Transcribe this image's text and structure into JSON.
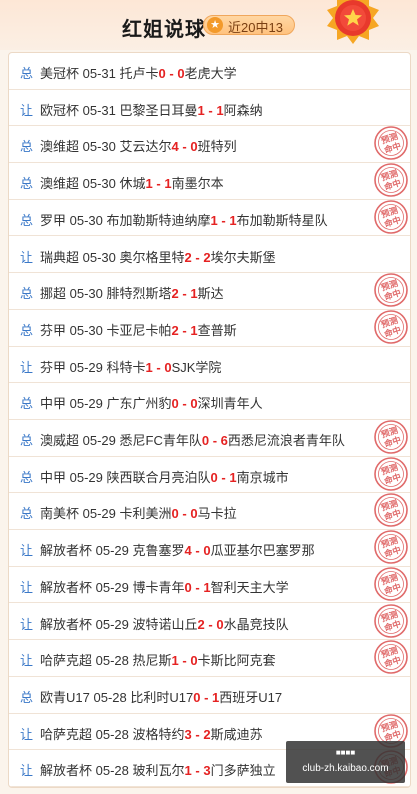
{
  "header": {
    "title": "红姐说球",
    "record": "近20中13",
    "star_icon": "star-icon",
    "medal_icon": "star-medal-icon"
  },
  "colors": {
    "accent": "#e52222",
    "type_label": "#3a78c8",
    "stamp": "#e06a6a"
  },
  "stamp_text": [
    "预测",
    "命中"
  ],
  "matches": [
    {
      "type": "总",
      "league": "美冠杯",
      "date": "05-31",
      "home": "托卢卡",
      "hs": "0",
      "as": "0",
      "away": "老虎大学",
      "hit": false
    },
    {
      "type": "让",
      "league": "欧冠杯",
      "date": "05-31",
      "home": "巴黎圣日耳曼",
      "hs": "1",
      "as": "1",
      "away": "阿森纳",
      "hit": false
    },
    {
      "type": "总",
      "league": "澳维超",
      "date": "05-30",
      "home": "艾云达尔",
      "hs": "4",
      "as": "0",
      "away": "班特列",
      "hit": true
    },
    {
      "type": "总",
      "league": "澳维超",
      "date": "05-30",
      "home": "休城",
      "hs": "1",
      "as": "1",
      "away": "南墨尔本",
      "hit": true
    },
    {
      "type": "总",
      "league": "罗甲",
      "date": "05-30",
      "home": "布加勒斯特迪纳摩",
      "hs": "1",
      "as": "1",
      "away": "布加勒斯特星队",
      "hit": true
    },
    {
      "type": "让",
      "league": "瑞典超",
      "date": "05-30",
      "home": "奥尔格里特",
      "hs": "2",
      "as": "2",
      "away": "埃尔夫斯堡",
      "hit": false
    },
    {
      "type": "总",
      "league": "挪超",
      "date": "05-30",
      "home": "腓特烈斯塔",
      "hs": "2",
      "as": "1",
      "away": "斯达",
      "hit": true
    },
    {
      "type": "总",
      "league": "芬甲",
      "date": "05-30",
      "home": "卡亚尼卡帕",
      "hs": "2",
      "as": "1",
      "away": "查普斯",
      "hit": true
    },
    {
      "type": "让",
      "league": "芬甲",
      "date": "05-29",
      "home": "科特卡",
      "hs": "1",
      "as": "0",
      "away": "SJK学院",
      "hit": false
    },
    {
      "type": "总",
      "league": "中甲",
      "date": "05-29",
      "home": "广东广州豹",
      "hs": "0",
      "as": "0",
      "away": "深圳青年人",
      "hit": false
    },
    {
      "type": "总",
      "league": "澳威超",
      "date": "05-29",
      "home": "悉尼FC青年队",
      "hs": "0",
      "as": "6",
      "away": "西悉尼流浪者青年队",
      "hit": true
    },
    {
      "type": "总",
      "league": "中甲",
      "date": "05-29",
      "home": "陕西联合月亮泊队",
      "hs": "0",
      "as": "1",
      "away": "南京城市",
      "hit": true
    },
    {
      "type": "总",
      "league": "南美杯",
      "date": "05-29",
      "home": "卡利美洲",
      "hs": "0",
      "as": "0",
      "away": "马卡拉",
      "hit": true
    },
    {
      "type": "让",
      "league": "解放者杯",
      "date": "05-29",
      "home": "克鲁塞罗",
      "hs": "4",
      "as": "0",
      "away": "瓜亚基尔巴塞罗那",
      "hit": true
    },
    {
      "type": "让",
      "league": "解放者杯",
      "date": "05-29",
      "home": "博卡青年",
      "hs": "0",
      "as": "1",
      "away": "智利天主大学",
      "hit": true
    },
    {
      "type": "让",
      "league": "解放者杯",
      "date": "05-29",
      "home": "波特诺山丘",
      "hs": "2",
      "as": "0",
      "away": "水晶竞技队",
      "hit": true
    },
    {
      "type": "让",
      "league": "哈萨克超",
      "date": "05-28",
      "home": "热尼斯",
      "hs": "1",
      "as": "0",
      "away": "卡斯比阿克套",
      "hit": true
    },
    {
      "type": "总",
      "league": "欧青U17",
      "date": "05-28",
      "home": "比利时U17",
      "hs": "0",
      "as": "1",
      "away": "西班牙U17",
      "hit": false
    },
    {
      "type": "让",
      "league": "哈萨克超",
      "date": "05-28",
      "home": "波格特约",
      "hs": "3",
      "as": "2",
      "away": "斯咸迪苏",
      "hit": true
    },
    {
      "type": "让",
      "league": "解放者杯",
      "date": "05-28",
      "home": "玻利瓦尔",
      "hs": "1",
      "as": "3",
      "away": "门多萨独立",
      "hit": true
    }
  ],
  "watermark": {
    "top": "■■■■",
    "bottom": "club-zh.kaibao.com"
  }
}
